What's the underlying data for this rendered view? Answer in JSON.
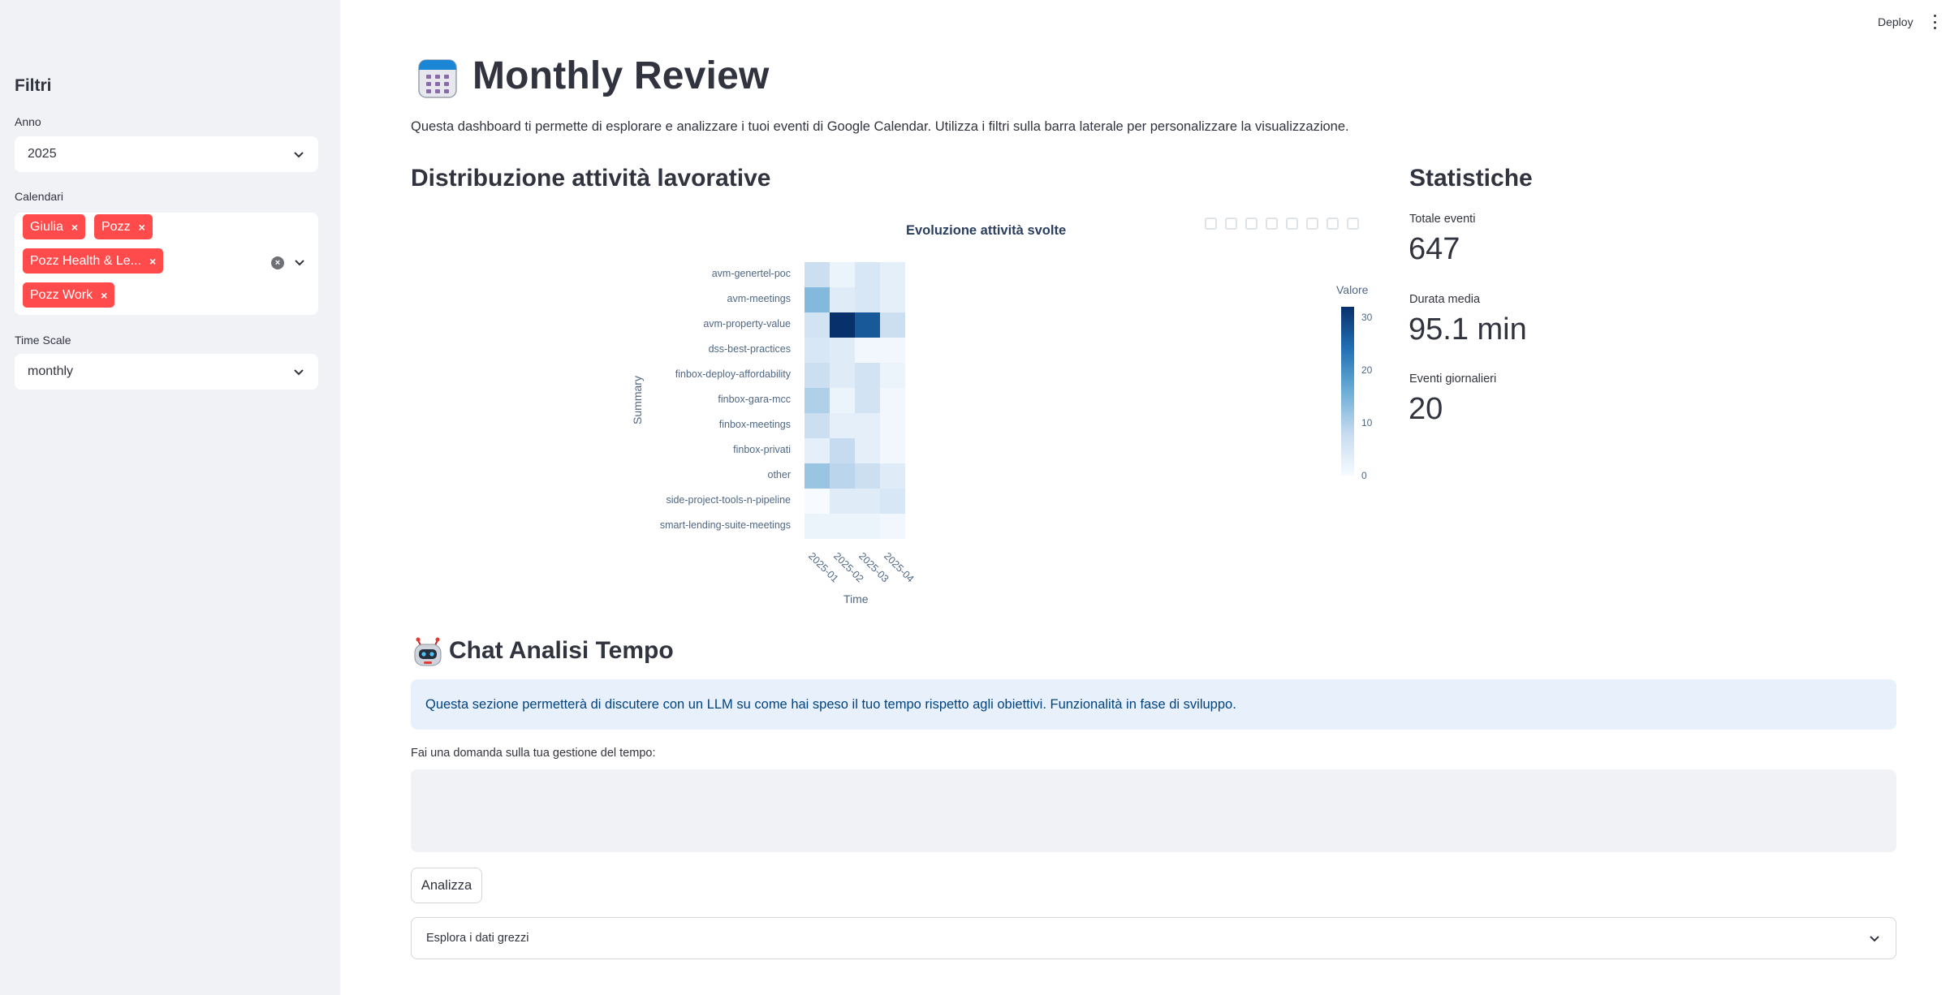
{
  "topbar": {
    "deploy_label": "Deploy",
    "menu_icon": "vertical-dots-icon"
  },
  "sidebar": {
    "title": "Filtri",
    "year": {
      "label": "Anno",
      "value": "2025"
    },
    "calendars": {
      "label": "Calendari",
      "selected": [
        "Giulia",
        "Pozz",
        "Pozz Health & Le...",
        "Pozz Work"
      ],
      "remove_glyph": "×",
      "clear_glyph": "×"
    },
    "time_scale": {
      "label": "Time Scale",
      "value": "monthly"
    }
  },
  "header": {
    "icon": "calendar-icon",
    "title": "Monthly Review",
    "intro": "Questa dashboard ti permette di esplorare e analizzare i tuoi eventi di Google Calendar. Utilizza i filtri sulla barra laterale per personalizzare la visualizzazione."
  },
  "distribution": {
    "heading": "Distribuzione attività lavorative"
  },
  "stats": {
    "heading": "Statistiche",
    "metrics": [
      {
        "label": "Totale eventi",
        "value": "647"
      },
      {
        "label": "Durata media",
        "value": "95.1 min"
      },
      {
        "label": "Eventi giornalieri",
        "value": "20"
      }
    ]
  },
  "chart_data": {
    "type": "heatmap",
    "title": "Evoluzione attività svolte",
    "xlabel": "Time",
    "ylabel": "Summary",
    "x": [
      "2025-01",
      "2025-02",
      "2025-03",
      "2025-04"
    ],
    "y": [
      "avm-genertel-poc",
      "avm-meetings",
      "avm-property-value",
      "dss-best-practices",
      "finbox-deploy-affordability",
      "finbox-gara-mcc",
      "finbox-meetings",
      "finbox-privati",
      "other",
      "side-project-tools-n-pipeline",
      "smart-lending-suite-meetings"
    ],
    "z": [
      [
        7,
        2,
        5,
        3
      ],
      [
        14,
        4,
        5,
        3
      ],
      [
        6,
        32,
        27,
        7
      ],
      [
        5,
        4,
        1,
        1
      ],
      [
        7,
        4,
        6,
        2
      ],
      [
        10,
        2,
        6,
        1
      ],
      [
        7,
        3,
        3,
        1
      ],
      [
        3,
        8,
        3,
        1
      ],
      [
        12,
        9,
        7,
        4
      ],
      [
        0,
        4,
        4,
        5
      ],
      [
        2,
        2,
        2,
        1
      ]
    ],
    "colorscale": "Blues",
    "zlim": [
      0,
      32
    ],
    "colorbar": {
      "title": "Valore",
      "ticks": [
        "30",
        "20",
        "10",
        "0"
      ],
      "tick_values": [
        30,
        20,
        10,
        0
      ]
    },
    "colors": {
      "low": "#f7fbff",
      "high": "#08306b"
    }
  },
  "chat": {
    "icon": "robot-icon",
    "heading": "Chat Analisi Tempo",
    "info": "Questa sezione permetterà di discutere con un LLM su come hai speso il tuo tempo rispetto agli obiettivi. Funzionalità in fase di sviluppo.",
    "question_label": "Fai una domanda sulla tua gestione del tempo:",
    "question_value": "",
    "button_label": "Analizza",
    "expander_label": "Esplora i dati grezzi"
  }
}
